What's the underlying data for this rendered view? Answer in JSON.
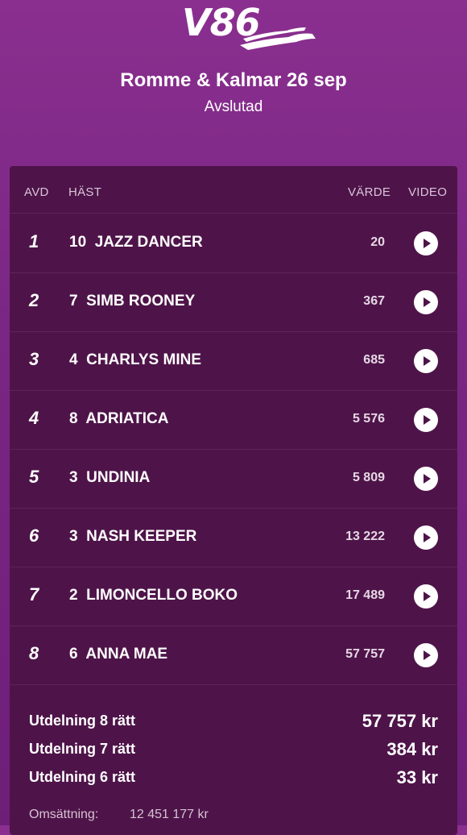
{
  "header": {
    "logo_text": "V86",
    "title": "Romme & Kalmar 26 sep",
    "status": "Avslutad"
  },
  "table": {
    "columns": [
      "AVD",
      "HÄST",
      "VÄRDE",
      "VIDEO"
    ],
    "rows": [
      {
        "avd": "1",
        "horse": "10  JAZZ DANCER",
        "value": "20"
      },
      {
        "avd": "2",
        "horse": "7  SIMB ROONEY",
        "value": "367"
      },
      {
        "avd": "3",
        "horse": "4  CHARLYS MINE",
        "value": "685"
      },
      {
        "avd": "4",
        "horse": "8  ADRIATICA",
        "value": "5 576"
      },
      {
        "avd": "5",
        "horse": "3  UNDINIA",
        "value": "5 809"
      },
      {
        "avd": "6",
        "horse": "3  NASH KEEPER",
        "value": "13 222"
      },
      {
        "avd": "7",
        "horse": "2  LIMONCELLO BOKO",
        "value": "17 489"
      },
      {
        "avd": "8",
        "horse": "6  ANNA MAE",
        "value": "57 757"
      }
    ]
  },
  "summary": {
    "payouts": [
      {
        "label": "Utdelning 8 rätt",
        "amount": "57 757 kr"
      },
      {
        "label": "Utdelning 7 rätt",
        "amount": "384 kr"
      },
      {
        "label": "Utdelning 6 rätt",
        "amount": "33 kr"
      }
    ],
    "turnover_label": "Omsättning:",
    "turnover_value": "12 451 177 kr"
  },
  "colors": {
    "background": "#7a2684",
    "card": "#4e1449",
    "accent": "#ffffff"
  }
}
